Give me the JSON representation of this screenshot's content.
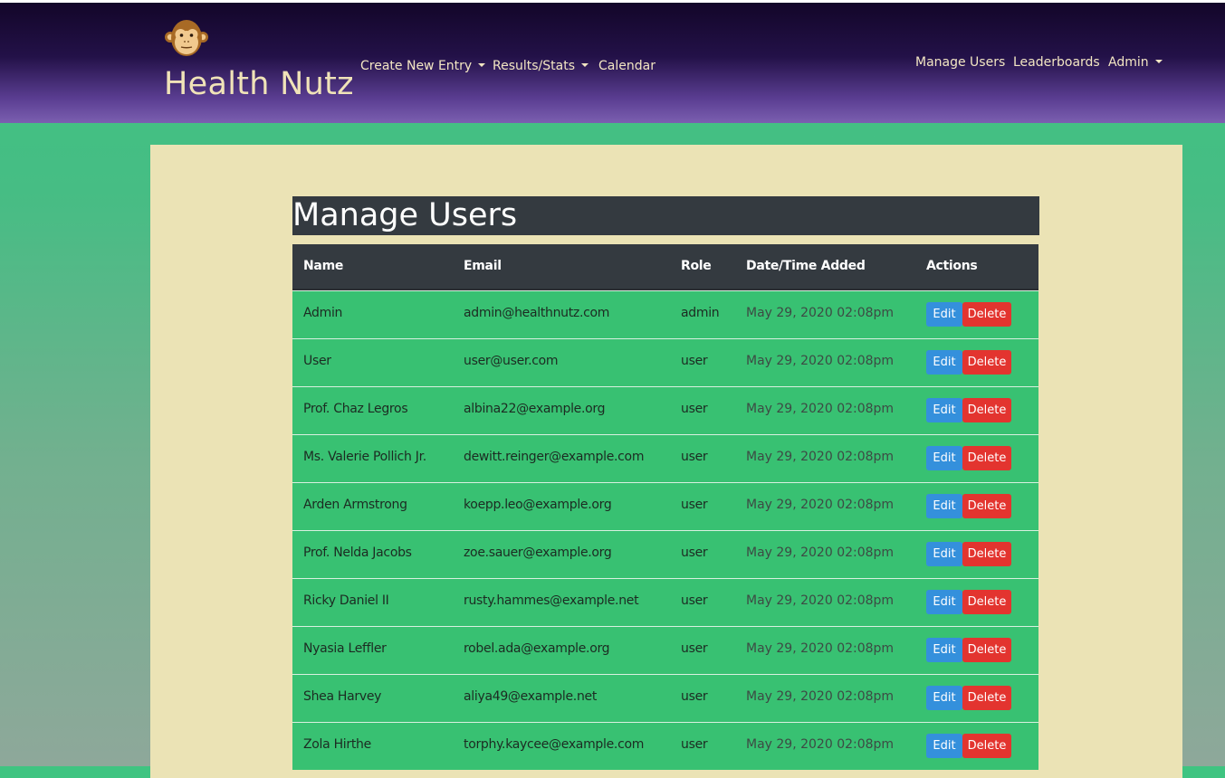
{
  "brand": {
    "name": "Health Nutz",
    "logo_icon": "monkey-face-icon"
  },
  "nav": {
    "left": [
      {
        "label": "Create New Entry",
        "dropdown": true
      },
      {
        "label": "Results/Stats",
        "dropdown": true
      },
      {
        "label": "Calendar",
        "dropdown": false
      }
    ],
    "right": [
      {
        "label": "Manage Users",
        "dropdown": false
      },
      {
        "label": "Leaderboards",
        "dropdown": false
      },
      {
        "label": "Admin",
        "dropdown": true
      }
    ]
  },
  "page": {
    "title": "Manage Users"
  },
  "table": {
    "headers": [
      "Name",
      "Email",
      "Role",
      "Date/Time Added",
      "Actions"
    ],
    "edit_label": "Edit",
    "delete_label": "Delete",
    "rows": [
      {
        "name": "Admin",
        "email": "admin@healthnutz.com",
        "role": "admin",
        "added": "May 29, 2020 02:08pm"
      },
      {
        "name": "User",
        "email": "user@user.com",
        "role": "user",
        "added": "May 29, 2020 02:08pm"
      },
      {
        "name": "Prof. Chaz Legros",
        "email": "albina22@example.org",
        "role": "user",
        "added": "May 29, 2020 02:08pm"
      },
      {
        "name": "Ms. Valerie Pollich Jr.",
        "email": "dewitt.reinger@example.com",
        "role": "user",
        "added": "May 29, 2020 02:08pm"
      },
      {
        "name": "Arden Armstrong",
        "email": "koepp.leo@example.org",
        "role": "user",
        "added": "May 29, 2020 02:08pm"
      },
      {
        "name": "Prof. Nelda Jacobs",
        "email": "zoe.sauer@example.org",
        "role": "user",
        "added": "May 29, 2020 02:08pm"
      },
      {
        "name": "Ricky Daniel II",
        "email": "rusty.hammes@example.net",
        "role": "user",
        "added": "May 29, 2020 02:08pm"
      },
      {
        "name": "Nyasia Leffler",
        "email": "robel.ada@example.org",
        "role": "user",
        "added": "May 29, 2020 02:08pm"
      },
      {
        "name": "Shea Harvey",
        "email": "aliya49@example.net",
        "role": "user",
        "added": "May 29, 2020 02:08pm"
      },
      {
        "name": "Zola Hirthe",
        "email": "torphy.kaycee@example.com",
        "role": "user",
        "added": "May 29, 2020 02:08pm"
      }
    ]
  },
  "colors": {
    "navbar_top": "#130629",
    "navbar_bottom": "#7b5fb0",
    "page_background": "#3fc481",
    "panel": "#ebe3b5",
    "header_dark": "#343a40",
    "row_green": "#38c172",
    "edit_blue": "#3490dc",
    "delete_red": "#e3342f",
    "brand_text": "#f0e3b8"
  }
}
